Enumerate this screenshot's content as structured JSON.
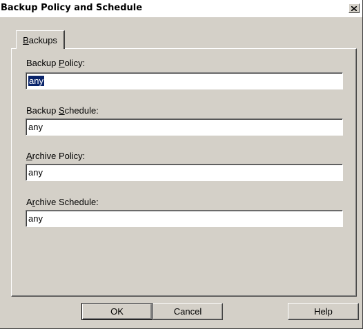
{
  "window": {
    "title": "Backup Policy and Schedule",
    "close_glyph": "×"
  },
  "tabs": [
    {
      "label_pre": "",
      "label_ul": "B",
      "label_post": "ackups"
    }
  ],
  "fields": {
    "backup_policy": {
      "label_pre": "Backup ",
      "label_ul": "P",
      "label_post": "olicy:",
      "value": "any",
      "selected": true
    },
    "backup_schedule": {
      "label_pre": "Backup ",
      "label_ul": "S",
      "label_post": "chedule:",
      "value": "any"
    },
    "archive_policy": {
      "label_pre": "",
      "label_ul": "A",
      "label_post": "rchive Policy:",
      "value": "any"
    },
    "archive_schedule": {
      "label_pre": "A",
      "label_ul": "r",
      "label_post": "chive Schedule:",
      "value": "any"
    }
  },
  "buttons": {
    "ok": "OK",
    "cancel": "Cancel",
    "help": "Help"
  },
  "colors": {
    "face": "#d4d0c8",
    "selection": "#0a246a"
  },
  "icons": {
    "close": "close-icon"
  }
}
